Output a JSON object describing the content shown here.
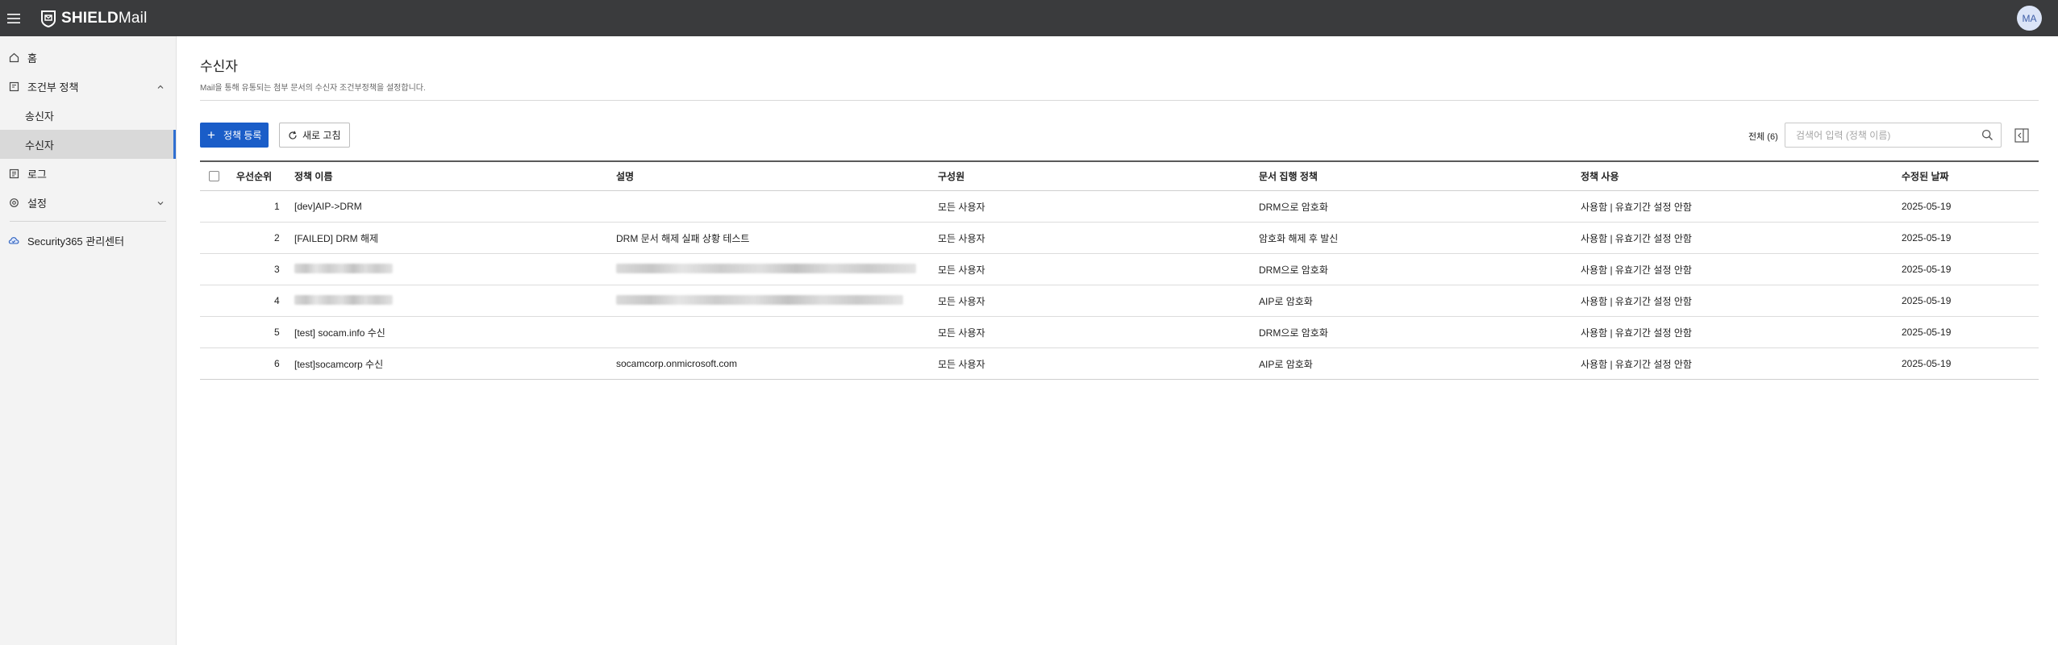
{
  "header": {
    "brand_bold": "SHIELD",
    "brand_light": "Mail",
    "avatar_initials": "MA"
  },
  "sidebar": {
    "items": [
      {
        "label": "홈",
        "icon": "home-icon"
      },
      {
        "label": "조건부 정책",
        "icon": "policy-doc-icon",
        "expanded": true,
        "children": [
          {
            "label": "송신자",
            "active": false
          },
          {
            "label": "수신자",
            "active": true
          }
        ]
      },
      {
        "label": "로그",
        "icon": "log-icon"
      },
      {
        "label": "설정",
        "icon": "gear-icon",
        "expanded": false
      },
      {
        "label": "Security365 관리센터",
        "icon": "cloud-icon"
      }
    ]
  },
  "page": {
    "title": "수신자",
    "description": "Mail을 통해 유통되는 첨부 문서의 수신자 조건부정책을 설정합니다."
  },
  "toolbar": {
    "add_label": "정책 등록",
    "refresh_label": "새로 고침",
    "total_label": "전체 (6)",
    "search_placeholder": "검색어 입력 (정책 이름)"
  },
  "table": {
    "columns": [
      "우선순위",
      "정책 이름",
      "설명",
      "구성원",
      "문서 집행 정책",
      "정책 사용",
      "수정된 날짜"
    ],
    "rows": [
      {
        "priority": "1",
        "name": "[dev]AIP->DRM",
        "description": "",
        "members": "모든 사용자",
        "exec_policy": "DRM으로 암호화",
        "usage": "사용함 | 유효기간 설정 안함",
        "modified": "2025-05-19"
      },
      {
        "priority": "2",
        "name": "[FAILED] DRM 해제",
        "description": "DRM 문서 해제 실패 상황 테스트",
        "members": "모든 사용자",
        "exec_policy": "암호화 해제 후 발신",
        "usage": "사용함 | 유효기간 설정 안함",
        "modified": "2025-05-19"
      },
      {
        "priority": "3",
        "name": "",
        "name_redacted": true,
        "description": "",
        "description_redacted": true,
        "members": "모든 사용자",
        "exec_policy": "DRM으로 암호화",
        "usage": "사용함 | 유효기간 설정 안함",
        "modified": "2025-05-19"
      },
      {
        "priority": "4",
        "name": "",
        "name_redacted": true,
        "description": "",
        "description_redacted": true,
        "members": "모든 사용자",
        "exec_policy": "AIP로 암호화",
        "usage": "사용함 | 유효기간 설정 안함",
        "modified": "2025-05-19"
      },
      {
        "priority": "5",
        "name": "[test] socam.info 수신",
        "description": "",
        "members": "모든 사용자",
        "exec_policy": "DRM으로 암호화",
        "usage": "사용함 | 유효기간 설정 안함",
        "modified": "2025-05-19"
      },
      {
        "priority": "6",
        "name": "[test]socamcorp 수신",
        "description": "socamcorp.onmicrosoft.com",
        "members": "모든 사용자",
        "exec_policy": "AIP로 암호화",
        "usage": "사용함 | 유효기간 설정 안함",
        "modified": "2025-05-19"
      }
    ]
  },
  "colors": {
    "topbar": "#3a3b3d",
    "primary": "#1a5dc8",
    "active_indicator": "#2f6fd1",
    "sidebar_bg": "#f3f3f3"
  }
}
